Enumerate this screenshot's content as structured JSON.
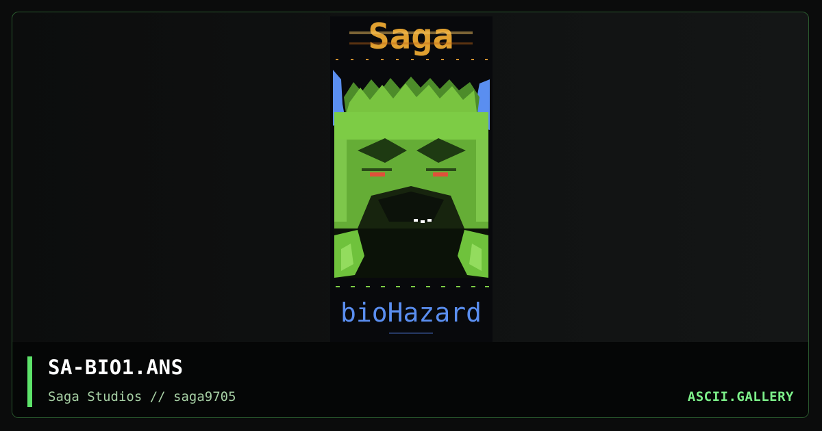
{
  "artwork": {
    "image_description": "ANSI artwork: green monster face with red eyes, 'Saga' logo at top, 'bioHazard' logo at bottom",
    "logo_top": "Saga",
    "logo_bottom": "bioHazard"
  },
  "info": {
    "title": "SA-BIO1.ANS",
    "subtitle": "Saga Studios // saga9705",
    "brand": "ASCII.GALLERY"
  },
  "colors": {
    "accent": "#5de36a",
    "brand": "#7df08a",
    "border": "#2a5a2e",
    "logo_top": "#e0a030",
    "logo_bottom": "#5a8ef0",
    "face": "#6fc23c",
    "eyes": "#e0503a"
  }
}
